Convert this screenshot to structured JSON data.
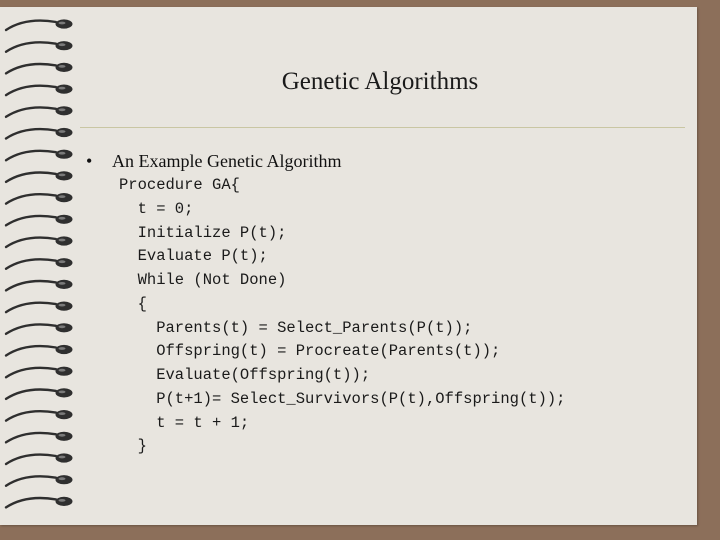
{
  "slide": {
    "title": "Genetic Algorithms",
    "bullet_symbol": "•",
    "bullet_text": "An Example Genetic Algorithm",
    "code_lines": [
      "Procedure GA{",
      "  t = 0;",
      "  Initialize P(t);",
      "  Evaluate P(t);",
      "  While (Not Done)",
      "  {",
      "    Parents(t) = Select_Parents(P(t));",
      "    Offspring(t) = Procreate(Parents(t));",
      "    Evaluate(Offspring(t));",
      "    P(t+1)= Select_Survivors(P(t),Offspring(t));",
      "    t = t + 1;",
      "  }"
    ]
  },
  "colors": {
    "background": "#8c6f5a",
    "paper": "#e8e5df",
    "rule": "#c9c6a3",
    "ring": "#2f2f2f"
  },
  "icons": {
    "binding": "spiral-binding-icon"
  }
}
